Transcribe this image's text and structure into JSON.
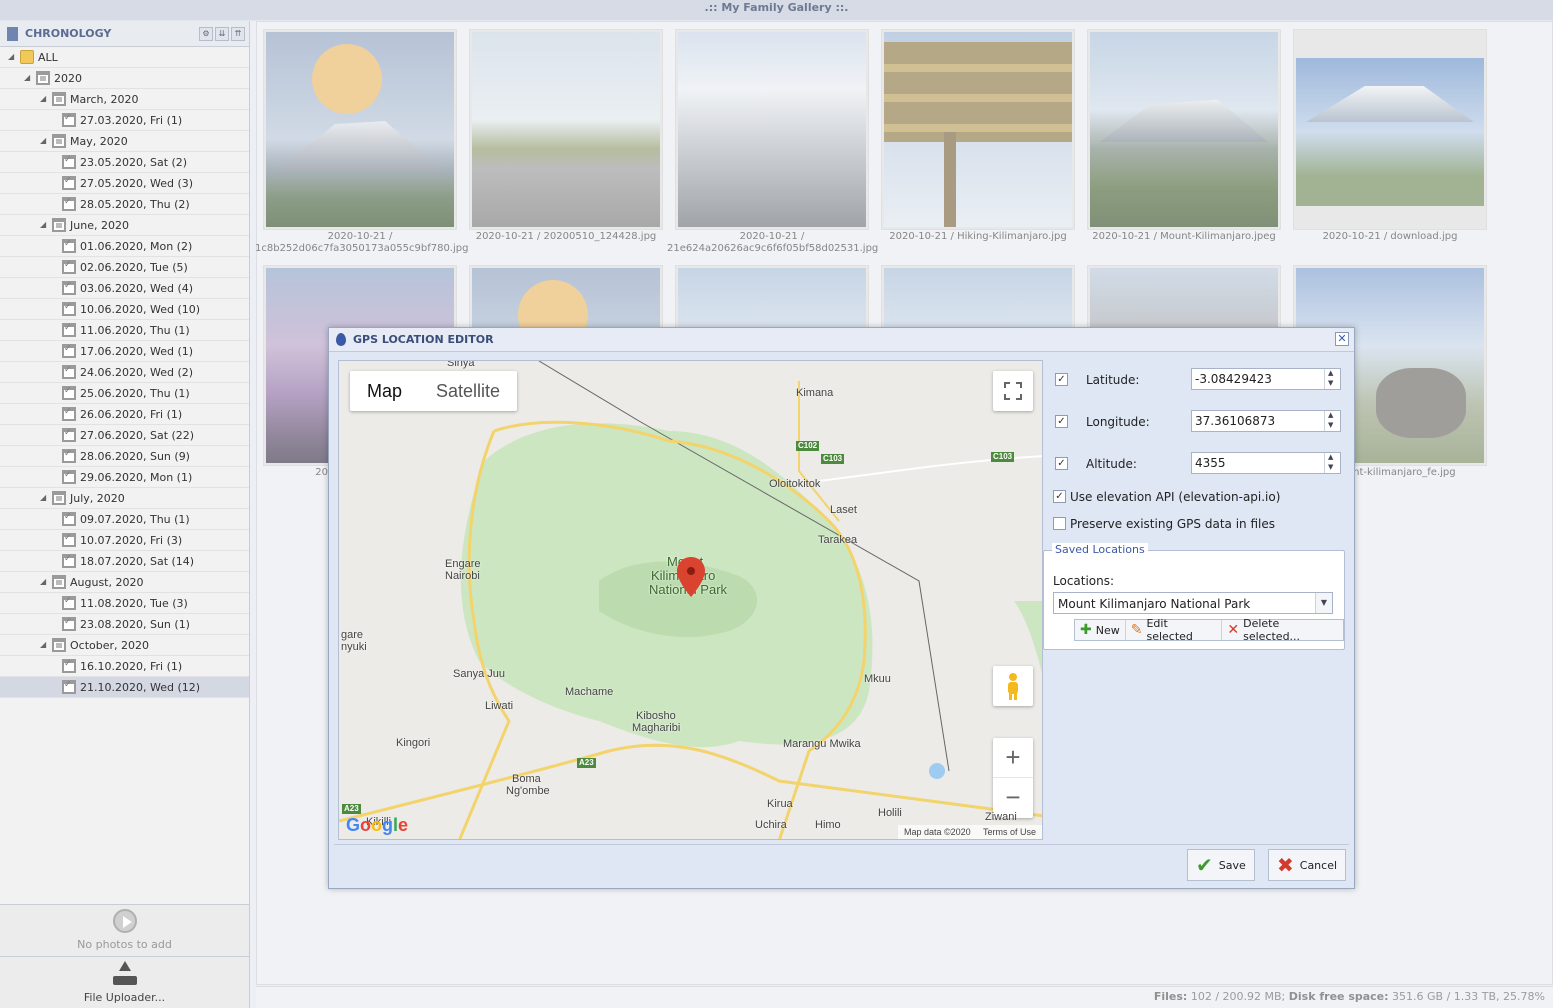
{
  "app_title": ".:: My Family Gallery ::.",
  "sidebar": {
    "title": "CHRONOLOGY",
    "tree": [
      {
        "label": "ALL",
        "level": 0,
        "icon": "folder"
      },
      {
        "label": "2020",
        "level": 1,
        "icon": "cal"
      },
      {
        "label": "March, 2020",
        "level": 2,
        "icon": "cal"
      },
      {
        "label": "27.03.2020, Fri (1)",
        "level": 3,
        "icon": "calchk"
      },
      {
        "label": "May, 2020",
        "level": 2,
        "icon": "cal"
      },
      {
        "label": "23.05.2020, Sat (2)",
        "level": 3,
        "icon": "calchk"
      },
      {
        "label": "27.05.2020, Wed (3)",
        "level": 3,
        "icon": "calchk"
      },
      {
        "label": "28.05.2020, Thu (2)",
        "level": 3,
        "icon": "calchk"
      },
      {
        "label": "June, 2020",
        "level": 2,
        "icon": "cal"
      },
      {
        "label": "01.06.2020, Mon (2)",
        "level": 3,
        "icon": "calchk"
      },
      {
        "label": "02.06.2020, Tue (5)",
        "level": 3,
        "icon": "calchk"
      },
      {
        "label": "03.06.2020, Wed (4)",
        "level": 3,
        "icon": "calchk"
      },
      {
        "label": "10.06.2020, Wed (10)",
        "level": 3,
        "icon": "calchk"
      },
      {
        "label": "11.06.2020, Thu (1)",
        "level": 3,
        "icon": "calchk"
      },
      {
        "label": "17.06.2020, Wed (1)",
        "level": 3,
        "icon": "calchk"
      },
      {
        "label": "24.06.2020, Wed (2)",
        "level": 3,
        "icon": "calchk"
      },
      {
        "label": "25.06.2020, Thu (1)",
        "level": 3,
        "icon": "calchk"
      },
      {
        "label": "26.06.2020, Fri (1)",
        "level": 3,
        "icon": "calchk"
      },
      {
        "label": "27.06.2020, Sat (22)",
        "level": 3,
        "icon": "calchk"
      },
      {
        "label": "28.06.2020, Sun (9)",
        "level": 3,
        "icon": "calchk"
      },
      {
        "label": "29.06.2020, Mon (1)",
        "level": 3,
        "icon": "calchk"
      },
      {
        "label": "July, 2020",
        "level": 2,
        "icon": "cal"
      },
      {
        "label": "09.07.2020, Thu (1)",
        "level": 3,
        "icon": "calchk"
      },
      {
        "label": "10.07.2020, Fri (3)",
        "level": 3,
        "icon": "calchk"
      },
      {
        "label": "18.07.2020, Sat (14)",
        "level": 3,
        "icon": "calchk"
      },
      {
        "label": "August, 2020",
        "level": 2,
        "icon": "cal"
      },
      {
        "label": "11.08.2020, Tue (3)",
        "level": 3,
        "icon": "calchk"
      },
      {
        "label": "23.08.2020, Sun (1)",
        "level": 3,
        "icon": "calchk"
      },
      {
        "label": "October, 2020",
        "level": 2,
        "icon": "cal"
      },
      {
        "label": "16.10.2020, Fri (1)",
        "level": 3,
        "icon": "calchk"
      },
      {
        "label": "21.10.2020, Wed (12)",
        "level": 3,
        "icon": "calchk",
        "selected": true
      }
    ],
    "slideshow_label": "No photos to add",
    "uploader_label": "File Uploader..."
  },
  "gallery": {
    "row1": [
      {
        "caption": "2020-10-21 / 1c8b252d06c7fa3050173a055c9bf780.jpg",
        "scene": "moon-peak"
      },
      {
        "caption": "2020-10-21 / 20200510_124428.jpg",
        "scene": "street"
      },
      {
        "caption": "2020-10-21 / 21e624a20626ac9c6f6f05bf58d02531.jpg",
        "scene": "snow-crater"
      },
      {
        "caption": "2020-10-21 / Hiking-Kilimanjaro.jpg",
        "scene": "sign"
      },
      {
        "caption": "2020-10-21 / Mount-Kilimanjaro.jpeg",
        "scene": "mountain"
      },
      {
        "caption": "2020-10-21 / download.jpg",
        "scene": "giraffe"
      }
    ],
    "row2": [
      {
        "caption": "2020-10-21 / -KILI",
        "scene": "purple"
      },
      {
        "caption": "",
        "scene": "moon-peak"
      },
      {
        "caption": "",
        "scene": "mountain"
      },
      {
        "caption": "",
        "scene": "mountain"
      },
      {
        "caption": "",
        "scene": "rocky"
      },
      {
        "caption": "/ mount-kilimanjaro_fe.jpg",
        "scene": "elephant"
      }
    ]
  },
  "statusbar": {
    "files_label": "Files:",
    "files_value": "102 / 200.92 MB;",
    "disk_label": "Disk free space:",
    "disk_value": "351.6 GB / 1.33 TB, 25.78%"
  },
  "dialog": {
    "title": "GPS LOCATION EDITOR",
    "map": {
      "type_map": "Map",
      "type_satellite": "Satellite",
      "labels": [
        {
          "text": "Sinya"
        },
        {
          "text": "Kimana"
        },
        {
          "text": "Oloitokitok"
        },
        {
          "text": "Laset"
        },
        {
          "text": "Tarakea"
        },
        {
          "text": "Engare"
        },
        {
          "text": "Nairobi"
        },
        {
          "text": "Mount"
        },
        {
          "text": "Kilimanjaro"
        },
        {
          "text": "National Park"
        },
        {
          "text": "gare"
        },
        {
          "text": "nyuki"
        },
        {
          "text": "Sanya Juu"
        },
        {
          "text": "Machame"
        },
        {
          "text": "Liwati"
        },
        {
          "text": "Kibosho"
        },
        {
          "text": "Magharibi"
        },
        {
          "text": "Mkuu"
        },
        {
          "text": "Kingori"
        },
        {
          "text": "Marangu Mwika"
        },
        {
          "text": "Boma"
        },
        {
          "text": "Ng'ombe"
        },
        {
          "text": "Kirua"
        },
        {
          "text": "Uchira"
        },
        {
          "text": "Himo"
        },
        {
          "text": "Holili"
        },
        {
          "text": "Ziwani"
        },
        {
          "text": "Kikilli"
        }
      ],
      "roads": [
        "C102",
        "C103",
        "C103",
        "A23",
        "A23"
      ],
      "google": "Google",
      "map_data": "Map data ©2020",
      "terms": "Terms of Use",
      "zoom_in": "+",
      "zoom_out": "−"
    },
    "latitude": {
      "label": "Latitude:",
      "value": "-3.08429423",
      "checked": true
    },
    "longitude": {
      "label": "Longitude:",
      "value": "37.36106873",
      "checked": true
    },
    "altitude": {
      "label": "Altitude:",
      "value": "4355",
      "checked": true
    },
    "use_elevation": {
      "label": "Use elevation API (elevation-api.io)",
      "checked": true
    },
    "preserve": {
      "label": "Preserve existing GPS data in files",
      "checked": false
    },
    "saved": {
      "legend": "Saved Locations",
      "locations_label": "Locations:",
      "selected": "Mount Kilimanjaro National Park",
      "new": "New",
      "edit": "Edit selected",
      "delete": "Delete selected..."
    },
    "save": "Save",
    "cancel": "Cancel"
  },
  "colors": {
    "accent": "#3a5aa6",
    "save_green": "#3d9a2c",
    "cancel_red": "#d33a2c",
    "park_green": "#cde6c2",
    "road_yellow": "#f3d36b"
  }
}
